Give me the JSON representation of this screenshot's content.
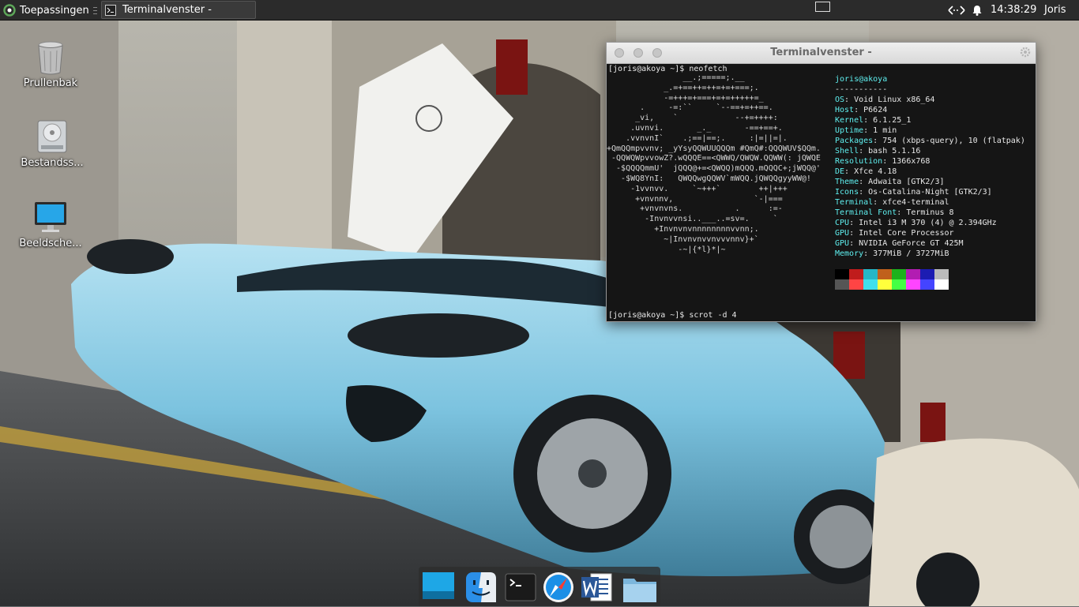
{
  "panel": {
    "apps_label": "Toepassingen",
    "task_title": "Terminalvenster -",
    "clock": "14:38:29",
    "user": "Joris"
  },
  "desktop_icons": [
    {
      "label": "Prullenbak",
      "icon": "trash-icon"
    },
    {
      "label": "Bestandss...",
      "icon": "drive-icon"
    },
    {
      "label": "Beeldsche...",
      "icon": "monitor-icon"
    }
  ],
  "terminal": {
    "title": "Terminalvenster -",
    "command1": "[joris@akoya ~]$ neofetch",
    "command2": "[joris@akoya ~]$ scrot -d 4",
    "logo_lines": [
      "                __.;=====;.__",
      "            _.=+==++=++=+=+===;.",
      "            -=+++=+===+=+=+++++=_",
      "       .     -=:``     `--==+=++==.",
      "      _vi,    `            --+=++++:",
      "     .uvnvi.       _._       -==+==+.",
      "    .vvnvnI`    .;==|==;.     :|=||=|.",
      "+QmQQmpvvnv; _yYsyQQWUUQQQm #QmQ#:QQQWUV$QQm.",
      " -QQWQWpvvowZ?.wQQQE==<QWWQ/QWQW.QQWW(: jQWQE",
      "  -$QQQQmmU'  jQQQ@+=<QWQQ)mQQQ.mQQQC+;jWQQ@'",
      "   -$WQ8YnI:   QWQQwgQQWV`mWQQ.jQWQQgyyWW@!",
      "     -1vvnvv.     `~+++`        ++|+++",
      "      +vnvnnv,                 `-|===",
      "       +vnvnvns.           .      :=-",
      "        -Invnvvnsi..___..=sv=.     `",
      "          +Invnvnvnnnnnnnnvvnn;.",
      "            ~|Invnvnvvnvvvnnv}+`",
      "               -~|{*l}*|~"
    ],
    "info": {
      "userhost": "joris@akoya",
      "separator": "-----------",
      "rows": [
        {
          "key": "OS",
          "value": "Void Linux x86_64"
        },
        {
          "key": "Host",
          "value": "P6624"
        },
        {
          "key": "Kernel",
          "value": "6.1.25_1"
        },
        {
          "key": "Uptime",
          "value": "1 min"
        },
        {
          "key": "Packages",
          "value": "754 (xbps-query), 10 (flatpak)"
        },
        {
          "key": "Shell",
          "value": "bash 5.1.16"
        },
        {
          "key": "Resolution",
          "value": "1366x768"
        },
        {
          "key": "DE",
          "value": "Xfce 4.18"
        },
        {
          "key": "Theme",
          "value": "Adwaita [GTK2/3]"
        },
        {
          "key": "Icons",
          "value": "Os-Catalina-Night [GTK2/3]"
        },
        {
          "key": "Terminal",
          "value": "xfce4-terminal"
        },
        {
          "key": "Terminal Font",
          "value": "Terminus 8"
        },
        {
          "key": "CPU",
          "value": "Intel i3 M 370 (4) @ 2.394GHz"
        },
        {
          "key": "GPU",
          "value": "Intel Core Processor"
        },
        {
          "key": "GPU",
          "value": "NVIDIA GeForce GT 425M"
        },
        {
          "key": "Memory",
          "value": "377MiB / 3727MiB"
        }
      ]
    },
    "palette_row1": [
      "#000000",
      "#c01c1c",
      "#26b6c6",
      "#c0601c",
      "#1cb21c",
      "#b21cb2",
      "#1c1cb2",
      "#bbbbbb"
    ],
    "palette_row2": [
      "#555555",
      "#ff4444",
      "#3fe0ee",
      "#ffff3c",
      "#44ff44",
      "#ff44ff",
      "#4444ff",
      "#ffffff"
    ]
  },
  "dock": [
    {
      "name": "dock-desktop",
      "icon": "desktop-icon"
    },
    {
      "name": "dock-finder",
      "icon": "finder-icon"
    },
    {
      "name": "dock-terminal",
      "icon": "terminal-icon"
    },
    {
      "name": "dock-safari",
      "icon": "compass-icon"
    },
    {
      "name": "dock-word",
      "icon": "word-icon"
    },
    {
      "name": "dock-files",
      "icon": "folder-icon"
    }
  ]
}
